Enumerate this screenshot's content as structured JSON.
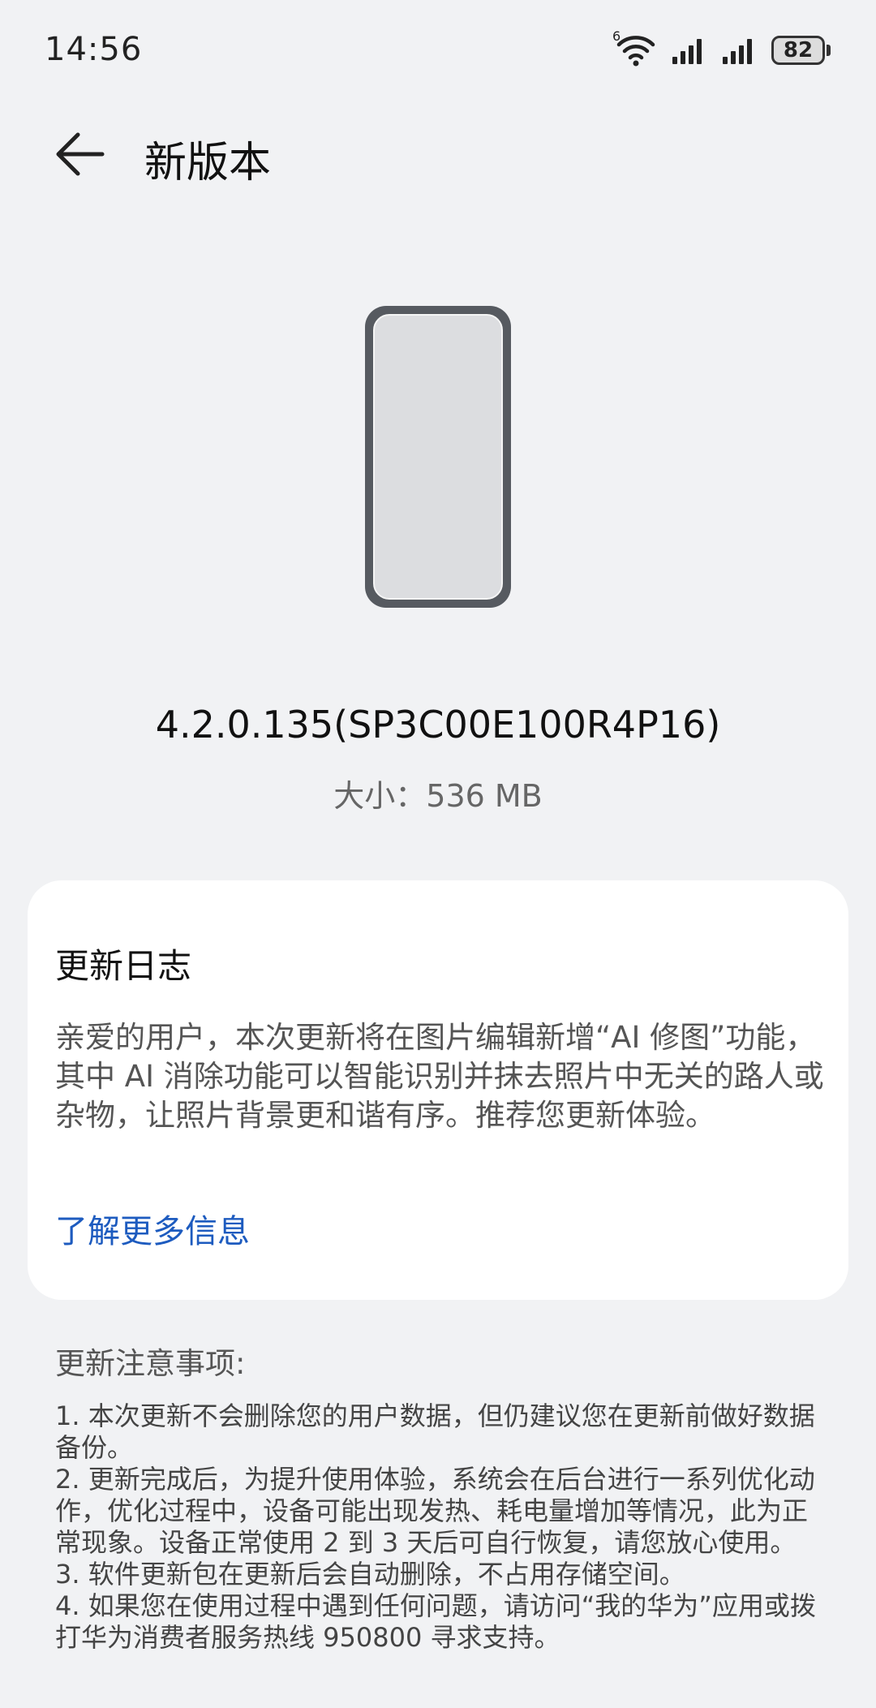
{
  "status_bar": {
    "time": "14:56",
    "wifi_tag": "6",
    "battery_level": "82",
    "icons": [
      "wifi-icon",
      "signal-icon",
      "signal-icon",
      "battery-icon"
    ]
  },
  "header": {
    "back_icon": "back-arrow-icon",
    "title": "新版本"
  },
  "update": {
    "version": "4.2.0.135(SP3C00E100R4P16)",
    "size": "大小：536 MB"
  },
  "changelog": {
    "title": "更新日志",
    "body": "亲爱的用户，本次更新将在图片编辑新增“AI 修图”功能，其中 AI 消除功能可以智能识别并抹去照片中无关的路人或杂物，让照片背景更和谐有序。推荐您更新体验。",
    "learn_more": "了解更多信息"
  },
  "notes": {
    "title": "更新注意事项:",
    "items": [
      "1. 本次更新不会删除您的用户数据，但仍建议您在更新前做好数据备份。",
      "2. 更新完成后，为提升使用体验，系统会在后台进行一系列优化动作，优化过程中，设备可能出现发热、耗电量增加等情况，此为正常现象。设备正常使用 2 到 3 天后可自行恢复，请您放心使用。",
      "3. 软件更新包在更新后会自动删除，不占用存储空间。",
      "4. 如果您在使用过程中遇到任何问题，请访问“我的华为”应用或拨打华为消费者服务热线 950800 寻求支持。"
    ]
  },
  "colors": {
    "background": "#f1f2f4",
    "card": "#ffffff",
    "link": "#1d5bbf"
  }
}
